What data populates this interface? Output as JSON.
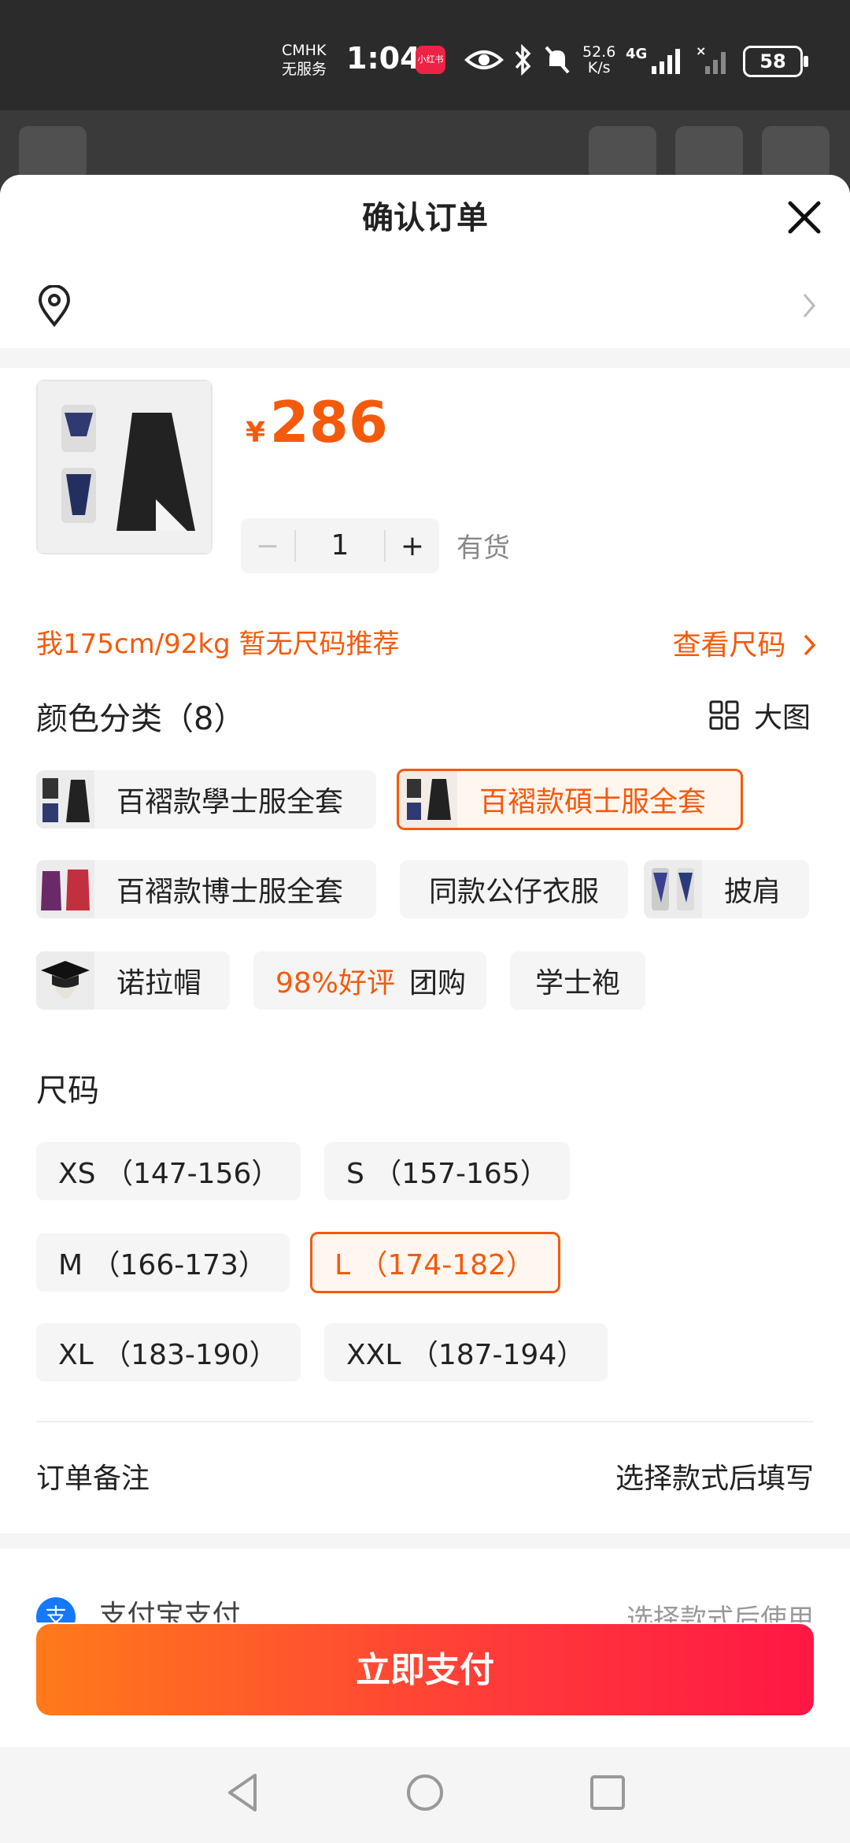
{
  "status_bar": {
    "carrier": "CMHK",
    "carrier_status": "无服务",
    "time": "1:04",
    "app_badge": "小红书",
    "net_speed_value": "52.6",
    "net_speed_unit": "K/s",
    "network": "4G",
    "battery": "58"
  },
  "dialog": {
    "title": "确认订单"
  },
  "product": {
    "currency": "¥",
    "price": "286",
    "quantity": "1",
    "minus_label": "−",
    "plus_label": "+",
    "stock": "有货"
  },
  "size_hint": {
    "text": "我175cm/92kg 暂无尺码推荐",
    "link": "查看尺码"
  },
  "color_section": {
    "title": "颜色分类（8）",
    "big_view": "大图",
    "options": [
      {
        "label": "百褶款學士服全套",
        "selected": false
      },
      {
        "label": "百褶款碩士服全套",
        "selected": true
      },
      {
        "label": "百褶款博士服全套",
        "selected": false
      },
      {
        "label": "同款公仔衣服",
        "selected": false
      },
      {
        "label": "披肩",
        "selected": false
      },
      {
        "label": "诺拉帽",
        "selected": false
      },
      {
        "label_badge": "98%好评",
        "label": "团购",
        "selected": false
      },
      {
        "label": "学士袍",
        "selected": false
      }
    ]
  },
  "size_section": {
    "title": "尺码",
    "options": [
      {
        "label": "XS （147-156）",
        "selected": false
      },
      {
        "label": "S （157-165）",
        "selected": false
      },
      {
        "label": "M （166-173）",
        "selected": false
      },
      {
        "label": "L （174-182）",
        "selected": true
      },
      {
        "label": "XL （183-190）",
        "selected": false
      },
      {
        "label": "XXL （187-194）",
        "selected": false
      }
    ]
  },
  "order_note": {
    "label": "订单备注",
    "value": "选择款式后填写"
  },
  "payment": {
    "method": "支付宝支付",
    "note": "选择款式后使用",
    "pay_button": "立即支付"
  },
  "colors": {
    "accent": "#f45a0c",
    "button_start": "#ff7a1a",
    "button_end": "#ff1744"
  }
}
